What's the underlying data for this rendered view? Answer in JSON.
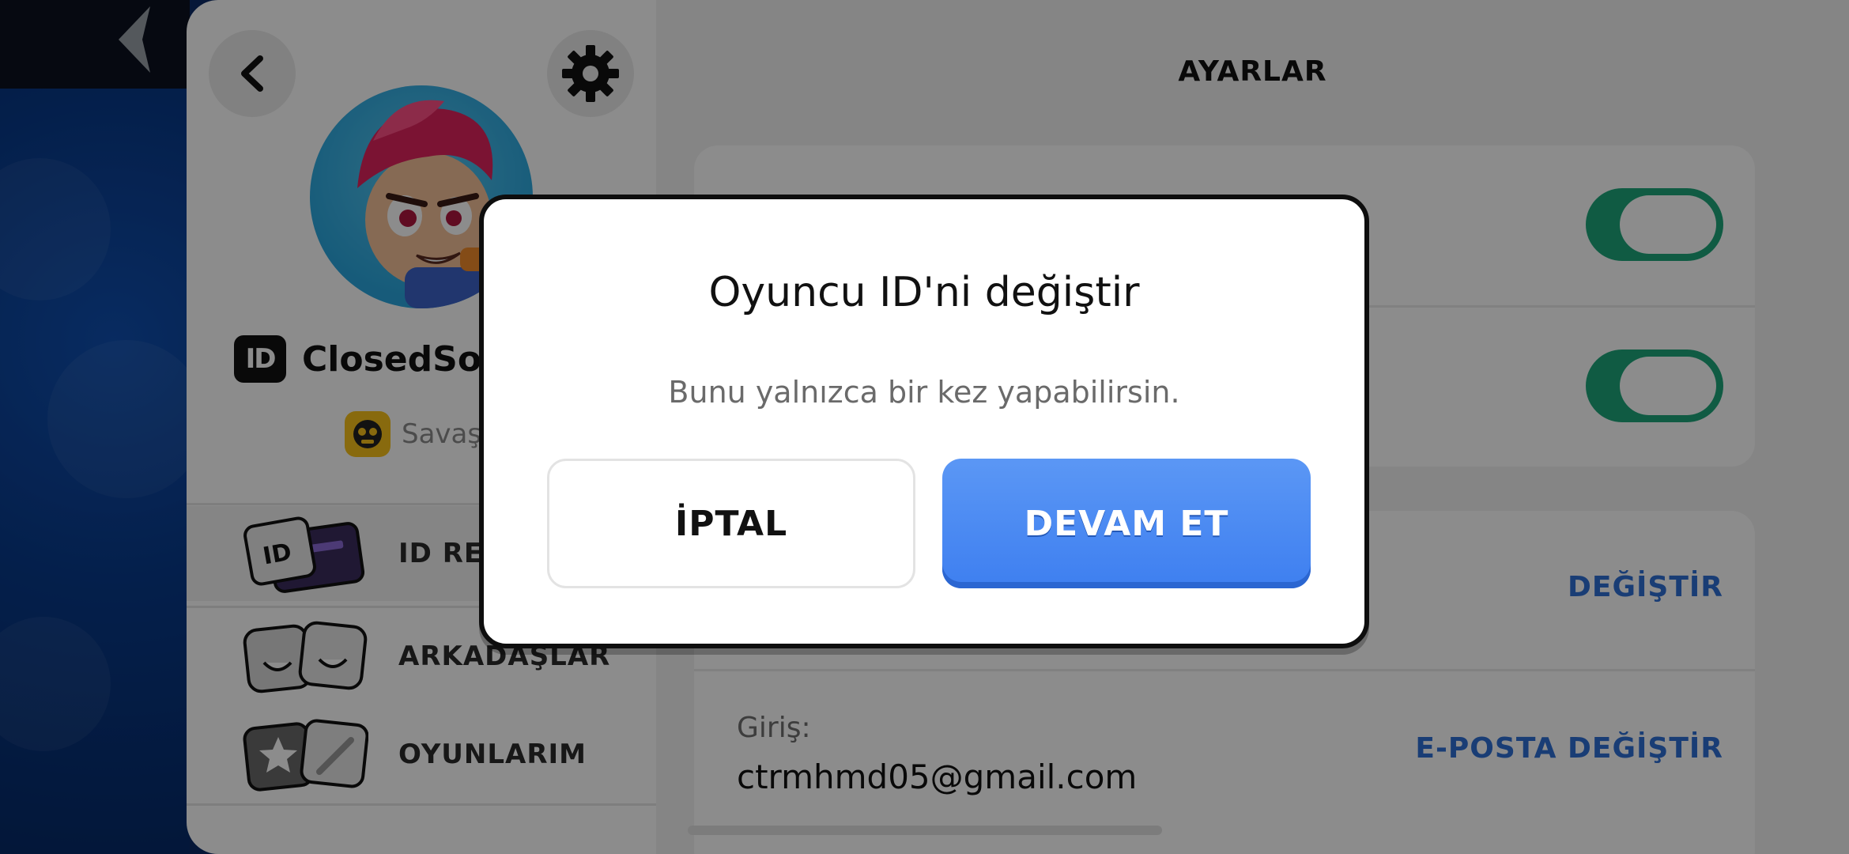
{
  "left_panel": {
    "username": "ClosedSoku",
    "id_badge": "ID",
    "club_name": "Savaş",
    "menu": [
      {
        "label": "ID REV"
      },
      {
        "label": "ARKADAŞLAR"
      },
      {
        "label": "OYUNLARIM"
      }
    ]
  },
  "settings": {
    "title": "AYARLAR",
    "toggles": [
      {
        "state": "on"
      },
      {
        "state": "on"
      }
    ],
    "change_label": "DEĞİŞTİR",
    "login_label": "Giriş:",
    "login_email": "ctrmhmd05@gmail.com",
    "change_email_label": "E-POSTA DEĞİŞTİR"
  },
  "dialog": {
    "title": "Oyuncu ID'ni değiştir",
    "message": "Bunu yalnızca bir kez yapabilirsin.",
    "cancel_label": "İPTAL",
    "continue_label": "DEVAM ET"
  },
  "colors": {
    "accent_green": "#1ea77a",
    "accent_blue": "#2f6fd6",
    "button_blue": "#3e7ff0"
  }
}
